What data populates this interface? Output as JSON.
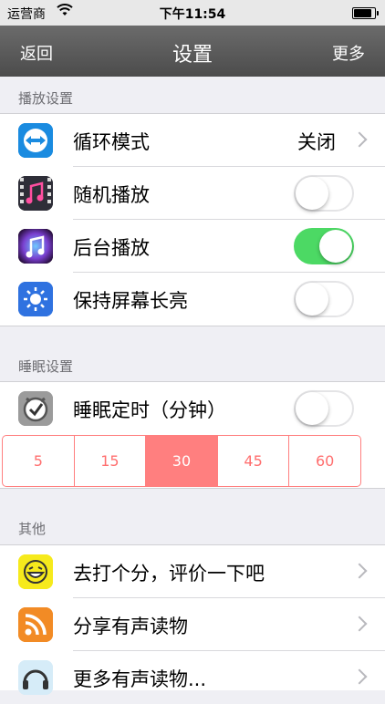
{
  "status_bar": {
    "carrier": "运营商",
    "time": "下午11:54",
    "battery_level": 0.95
  },
  "nav": {
    "back_label": "返回",
    "title": "设置",
    "more_label": "更多"
  },
  "sections": {
    "playback": {
      "header": "播放设置",
      "loop_mode": {
        "label": "循环模式",
        "value": "关闭"
      },
      "shuffle": {
        "label": "随机播放",
        "on": false
      },
      "background": {
        "label": "后台播放",
        "on": true
      },
      "keep_screen_on": {
        "label": "保持屏幕长亮",
        "on": false
      }
    },
    "sleep": {
      "header": "睡眠设置",
      "sleep_timer": {
        "label": "睡眠定时（分钟）",
        "on": false
      },
      "durations": [
        "5",
        "15",
        "30",
        "45",
        "60"
      ],
      "selected_duration": "30"
    },
    "other": {
      "header": "其他",
      "rate": {
        "label": "去打个分，评价一下吧"
      },
      "share": {
        "label": "分享有声读物"
      },
      "more_books": {
        "label": "更多有声读物..."
      }
    }
  },
  "colors": {
    "toggle_on": "#4cd964",
    "segment_accent": "#ff7f7f",
    "nav_bar": "#555555"
  }
}
